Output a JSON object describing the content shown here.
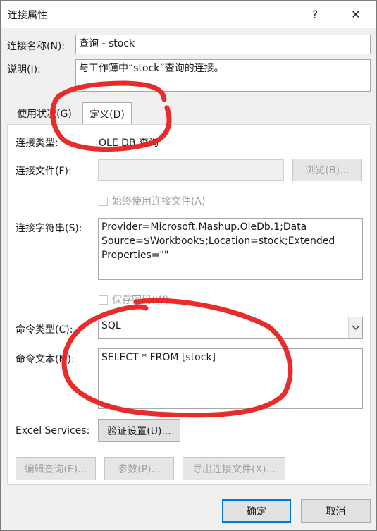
{
  "window": {
    "title": "连接属性",
    "help_glyph": "?",
    "close_glyph": "✕"
  },
  "connection_name": {
    "label": "连接名称(N):",
    "value": "查询 - stock"
  },
  "description": {
    "label": "说明(I):",
    "value": "与工作簿中“stock”查询的连接。"
  },
  "tabs": [
    {
      "label": "使用状况(G)"
    },
    {
      "label": "定义(D)"
    }
  ],
  "definition": {
    "type_label": "连接类型:",
    "type_value": "OLE DB 查询",
    "file_label": "连接文件(F):",
    "file_value": "",
    "browse_button": "浏览(B)...",
    "always_use_file": "始终使用连接文件(A)",
    "conn_string_label": "连接字符串(S):",
    "conn_string_value": "Provider=Microsoft.Mashup.OleDb.1;Data Source=$Workbook$;Location=stock;Extended Properties=\"\"",
    "save_password": "保存密码(W)",
    "cmd_type_label": "命令类型(C):",
    "cmd_type_value": "SQL",
    "cmd_text_label": "命令文本(M):",
    "cmd_text_value": "SELECT * FROM [stock]",
    "excel_services_label": "Excel Services:",
    "auth_button": "验证设置(U)...",
    "edit_query_button": "编辑查询(E)...",
    "params_button": "参数(P)...",
    "export_button": "导出连接文件(X)..."
  },
  "footer": {
    "ok": "确定",
    "cancel": "取消"
  },
  "annotation_color": "#e8201f"
}
